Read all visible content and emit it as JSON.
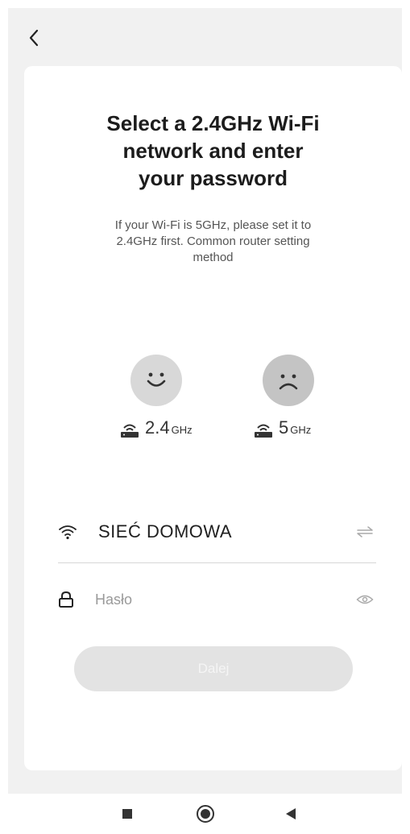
{
  "header": {
    "back_icon": "chevron-left-icon"
  },
  "card": {
    "title_lines": [
      "Select a 2.4GHz Wi-Fi",
      "network and enter",
      "your password"
    ],
    "subtitle_lines": [
      "If your Wi-Fi is 5GHz, please set it to",
      "2.4GHz first. Common router setting",
      "method"
    ],
    "bands": [
      {
        "face_icon": "smiley-icon",
        "router_icon": "router-icon",
        "num": "2.4",
        "unit": "GHz"
      },
      {
        "face_icon": "sad-face-icon",
        "router_icon": "router-icon",
        "num": "5",
        "unit": "GHz"
      }
    ],
    "wifi": {
      "icon": "wifi-icon",
      "ssid": "SIEĆ DOMOWA",
      "switch_icon": "swap-arrows-icon"
    },
    "password": {
      "icon": "lock-icon",
      "placeholder": "Hasło",
      "value": "",
      "visibility_icon": "eye-icon"
    },
    "next_label": "Dalej"
  },
  "system_nav": {
    "recents_icon": "square-icon",
    "home_icon": "circle-icon",
    "back_icon": "triangle-back-icon"
  },
  "colors": {
    "background": "#f1f1f1",
    "card": "#ffffff",
    "button_disabled": "#e3e3e3"
  }
}
